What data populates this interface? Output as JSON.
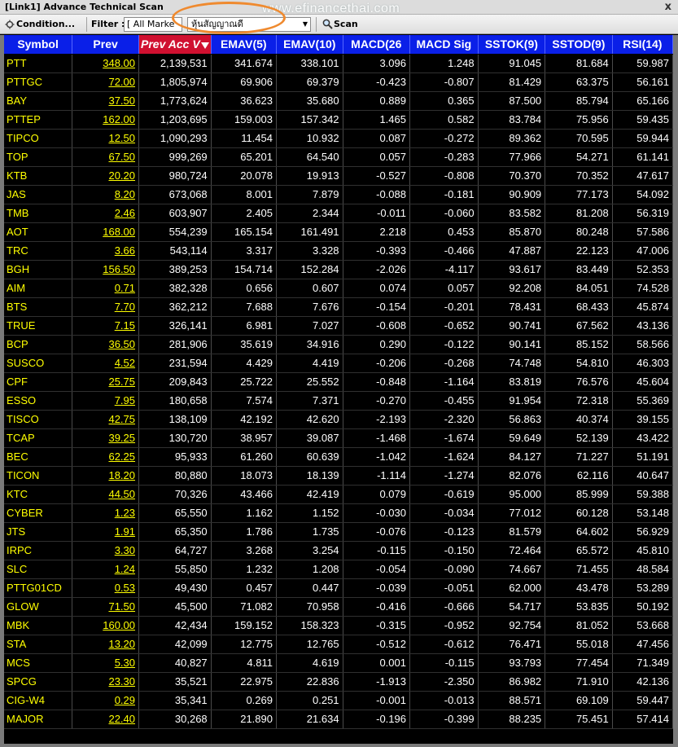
{
  "window": {
    "title": "[Link1] Advance Technical Scan",
    "close_label": "x"
  },
  "watermark": "www.efinancethai.com",
  "toolbar": {
    "condition_label": "Condition...",
    "filter_label": "Filter :",
    "market_value": "[ All Marke",
    "theme_value": "หุ้นสัญญาณดี",
    "scan_label": "Scan"
  },
  "table": {
    "columns": [
      "Symbol",
      "Prev",
      "Prev Acc V",
      "EMAV(5)",
      "EMAV(10)",
      "MACD(26",
      "MACD Sig",
      "SSTOK(9)",
      "SSTOD(9)",
      "RSI(14)"
    ],
    "sorted_column": "Prev Acc V",
    "rows": [
      [
        "PTT",
        "348.00",
        "2,139,531",
        "341.674",
        "338.101",
        "3.096",
        "1.248",
        "91.045",
        "81.684",
        "59.987"
      ],
      [
        "PTTGC",
        "72.00",
        "1,805,974",
        "69.906",
        "69.379",
        "-0.423",
        "-0.807",
        "81.429",
        "63.375",
        "56.161"
      ],
      [
        "BAY",
        "37.50",
        "1,773,624",
        "36.623",
        "35.680",
        "0.889",
        "0.365",
        "87.500",
        "85.794",
        "65.166"
      ],
      [
        "PTTEP",
        "162.00",
        "1,203,695",
        "159.003",
        "157.342",
        "1.465",
        "0.582",
        "83.784",
        "75.956",
        "59.435"
      ],
      [
        "TIPCO",
        "12.50",
        "1,090,293",
        "11.454",
        "10.932",
        "0.087",
        "-0.272",
        "89.362",
        "70.595",
        "59.944"
      ],
      [
        "TOP",
        "67.50",
        "999,269",
        "65.201",
        "64.540",
        "0.057",
        "-0.283",
        "77.966",
        "54.271",
        "61.141"
      ],
      [
        "KTB",
        "20.20",
        "980,724",
        "20.078",
        "19.913",
        "-0.527",
        "-0.808",
        "70.370",
        "70.352",
        "47.617"
      ],
      [
        "JAS",
        "8.20",
        "673,068",
        "8.001",
        "7.879",
        "-0.088",
        "-0.181",
        "90.909",
        "77.173",
        "54.092"
      ],
      [
        "TMB",
        "2.46",
        "603,907",
        "2.405",
        "2.344",
        "-0.011",
        "-0.060",
        "83.582",
        "81.208",
        "56.319"
      ],
      [
        "AOT",
        "168.00",
        "554,239",
        "165.154",
        "161.491",
        "2.218",
        "0.453",
        "85.870",
        "80.248",
        "57.586"
      ],
      [
        "TRC",
        "3.66",
        "543,114",
        "3.317",
        "3.328",
        "-0.393",
        "-0.466",
        "47.887",
        "22.123",
        "47.006"
      ],
      [
        "BGH",
        "156.50",
        "389,253",
        "154.714",
        "152.284",
        "-2.026",
        "-4.117",
        "93.617",
        "83.449",
        "52.353"
      ],
      [
        "AIM",
        "0.71",
        "382,328",
        "0.656",
        "0.607",
        "0.074",
        "0.057",
        "92.208",
        "84.051",
        "74.528"
      ],
      [
        "BTS",
        "7.70",
        "362,212",
        "7.688",
        "7.676",
        "-0.154",
        "-0.201",
        "78.431",
        "68.433",
        "45.874"
      ],
      [
        "TRUE",
        "7.15",
        "326,141",
        "6.981",
        "7.027",
        "-0.608",
        "-0.652",
        "90.741",
        "67.562",
        "43.136"
      ],
      [
        "BCP",
        "36.50",
        "281,906",
        "35.619",
        "34.916",
        "0.290",
        "-0.122",
        "90.141",
        "85.152",
        "58.566"
      ],
      [
        "SUSCO",
        "4.52",
        "231,594",
        "4.429",
        "4.419",
        "-0.206",
        "-0.268",
        "74.748",
        "54.810",
        "46.303"
      ],
      [
        "CPF",
        "25.75",
        "209,843",
        "25.722",
        "25.552",
        "-0.848",
        "-1.164",
        "83.819",
        "76.576",
        "45.604"
      ],
      [
        "ESSO",
        "7.95",
        "180,658",
        "7.574",
        "7.371",
        "-0.270",
        "-0.455",
        "91.954",
        "72.318",
        "55.369"
      ],
      [
        "TISCO",
        "42.75",
        "138,109",
        "42.192",
        "42.620",
        "-2.193",
        "-2.320",
        "56.863",
        "40.374",
        "39.155"
      ],
      [
        "TCAP",
        "39.25",
        "130,720",
        "38.957",
        "39.087",
        "-1.468",
        "-1.674",
        "59.649",
        "52.139",
        "43.422"
      ],
      [
        "BEC",
        "62.25",
        "95,933",
        "61.260",
        "60.639",
        "-1.042",
        "-1.624",
        "84.127",
        "71.227",
        "51.191"
      ],
      [
        "TICON",
        "18.20",
        "80,880",
        "18.073",
        "18.139",
        "-1.114",
        "-1.274",
        "82.076",
        "62.116",
        "40.647"
      ],
      [
        "KTC",
        "44.50",
        "70,326",
        "43.466",
        "42.419",
        "0.079",
        "-0.619",
        "95.000",
        "85.999",
        "59.388"
      ],
      [
        "CYBER",
        "1.23",
        "65,550",
        "1.162",
        "1.152",
        "-0.030",
        "-0.034",
        "77.012",
        "60.128",
        "53.148"
      ],
      [
        "JTS",
        "1.91",
        "65,350",
        "1.786",
        "1.735",
        "-0.076",
        "-0.123",
        "81.579",
        "64.602",
        "56.929"
      ],
      [
        "IRPC",
        "3.30",
        "64,727",
        "3.268",
        "3.254",
        "-0.115",
        "-0.150",
        "72.464",
        "65.572",
        "45.810"
      ],
      [
        "SLC",
        "1.24",
        "55,850",
        "1.232",
        "1.208",
        "-0.054",
        "-0.090",
        "74.667",
        "71.455",
        "48.584"
      ],
      [
        "PTTG01CD",
        "0.53",
        "49,430",
        "0.457",
        "0.447",
        "-0.039",
        "-0.051",
        "62.000",
        "43.478",
        "53.289"
      ],
      [
        "GLOW",
        "71.50",
        "45,500",
        "71.082",
        "70.958",
        "-0.416",
        "-0.666",
        "54.717",
        "53.835",
        "50.192"
      ],
      [
        "MBK",
        "160.00",
        "42,434",
        "159.152",
        "158.323",
        "-0.315",
        "-0.952",
        "92.754",
        "81.052",
        "53.668"
      ],
      [
        "STA",
        "13.20",
        "42,099",
        "12.775",
        "12.765",
        "-0.512",
        "-0.612",
        "76.471",
        "55.018",
        "47.456"
      ],
      [
        "MCS",
        "5.30",
        "40,827",
        "4.811",
        "4.619",
        "0.001",
        "-0.115",
        "93.793",
        "77.454",
        "71.349"
      ],
      [
        "SPCG",
        "23.30",
        "35,521",
        "22.975",
        "22.836",
        "-1.913",
        "-2.350",
        "86.982",
        "71.910",
        "42.136"
      ],
      [
        "CIG-W4",
        "0.29",
        "35,341",
        "0.269",
        "0.251",
        "-0.001",
        "-0.013",
        "88.571",
        "69.109",
        "59.447"
      ],
      [
        "MAJOR",
        "22.40",
        "30,268",
        "21.890",
        "21.634",
        "-0.196",
        "-0.399",
        "88.235",
        "75.451",
        "57.414"
      ]
    ]
  },
  "colors": {
    "header_bg": "#0a1fe8",
    "sorted_header_bg": "#d01030",
    "grid_bg": "#000000",
    "symbol_text": "#ffff00",
    "highlight_ring": "#ef8a2f"
  }
}
